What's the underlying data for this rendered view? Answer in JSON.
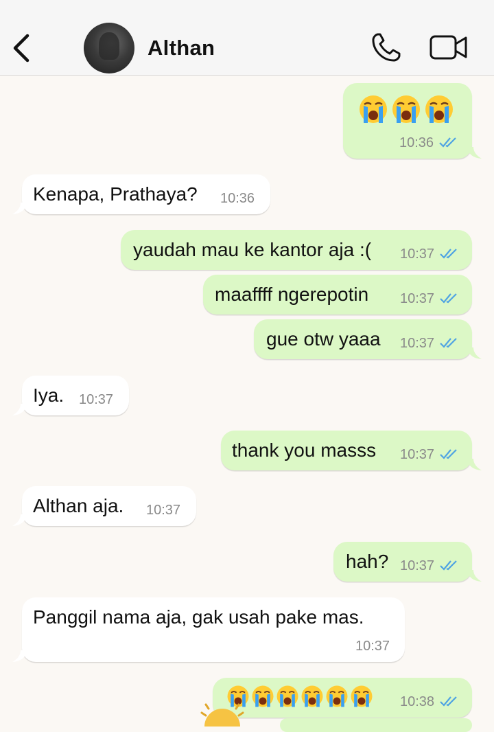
{
  "header": {
    "contact_name": "Althan",
    "back_icon": "chevron-left-icon",
    "call_icon": "phone-icon",
    "video_icon": "video-camera-icon",
    "avatar_icon": "contact-avatar"
  },
  "messages": [
    {
      "direction": "out",
      "text": "😭😭😭",
      "time": "10:36",
      "status": "read",
      "emoji_only": true,
      "emoji": "loudly-crying-face",
      "count": 3
    },
    {
      "direction": "in",
      "text": "Kenapa, Prathaya?",
      "time": "10:36"
    },
    {
      "direction": "out",
      "text": "yaudah mau ke kantor aja :(",
      "time": "10:37",
      "status": "read"
    },
    {
      "direction": "out",
      "text": "maaffff ngerepotin",
      "time": "10:37",
      "status": "read"
    },
    {
      "direction": "out",
      "text": "gue otw yaaa",
      "time": "10:37",
      "status": "read"
    },
    {
      "direction": "in",
      "text": "Iya.",
      "time": "10:37"
    },
    {
      "direction": "out",
      "text": "thank you masss",
      "time": "10:37",
      "status": "read"
    },
    {
      "direction": "in",
      "text": "Althan aja.",
      "time": "10:37"
    },
    {
      "direction": "out",
      "text": "hah?",
      "time": "10:37",
      "status": "read"
    },
    {
      "direction": "in",
      "text": "Panggil nama aja, gak usah pake mas.",
      "time": "10:37"
    },
    {
      "direction": "out",
      "text": "😭😭😭😭😭😭",
      "time": "10:38",
      "status": "read",
      "emoji_only": true,
      "emoji": "loudly-crying-face",
      "count": 6
    }
  ],
  "colors": {
    "chat_background": "#fbf8f4",
    "outgoing_bubble": "#dcf8c6",
    "incoming_bubble": "#ffffff",
    "read_ticks": "#4fa3e3",
    "timestamp": "#8a8a8a"
  }
}
